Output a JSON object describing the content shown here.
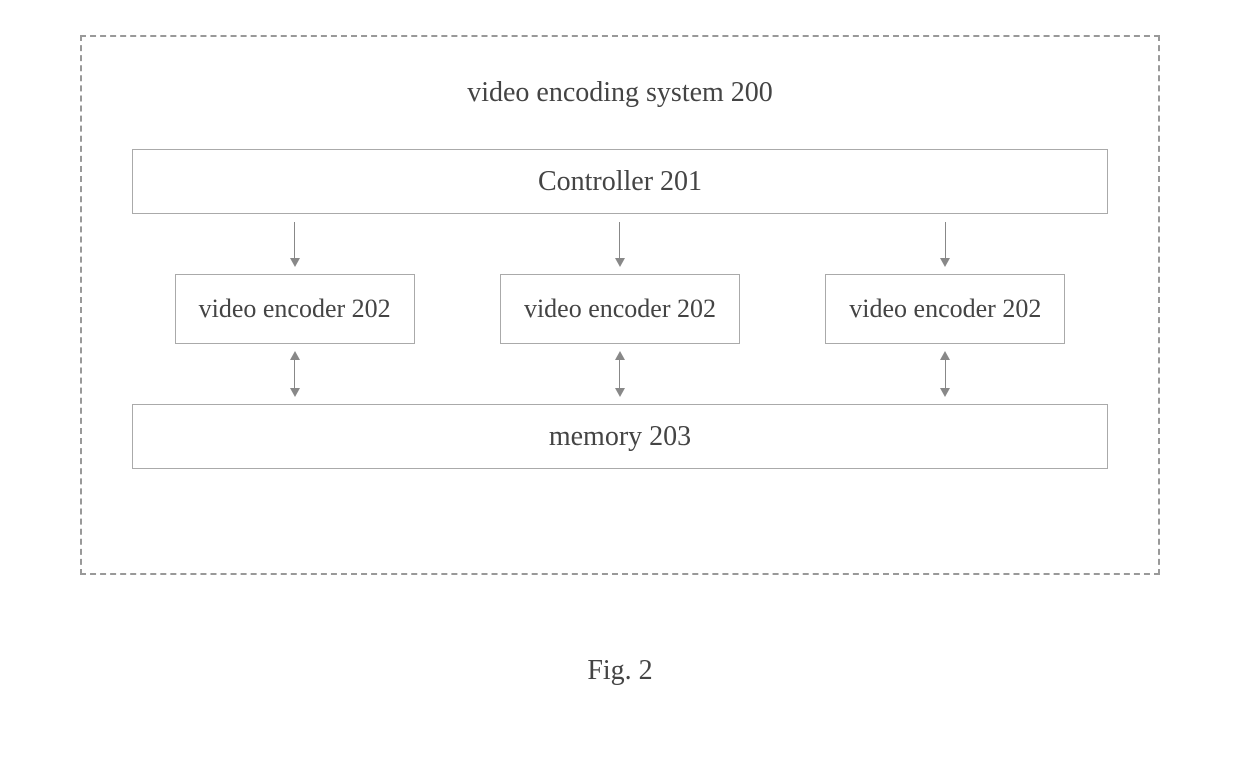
{
  "diagram": {
    "system_title": "video encoding system 200",
    "controller_label": "Controller 201",
    "encoders": [
      {
        "label": "video encoder 202"
      },
      {
        "label": "video encoder 202"
      },
      {
        "label": "video encoder 202"
      }
    ],
    "memory_label": "memory 203",
    "figure_caption": "Fig.  2"
  }
}
